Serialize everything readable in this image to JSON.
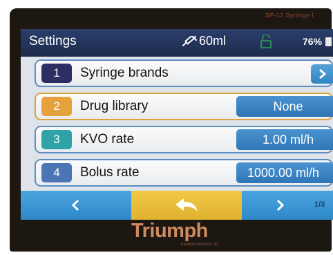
{
  "device": {
    "model": "SP-12 Syringe I",
    "brand": "Triumph",
    "brand_sub": "medical services, llc"
  },
  "status": {
    "title": "Settings",
    "syringe_volume": "60ml",
    "battery": "76%"
  },
  "rows": [
    {
      "num": "1",
      "label": "Syringe brands",
      "num_color": "#2d2f64"
    },
    {
      "num": "2",
      "label": "Drug library",
      "value": "None",
      "num_color": "#e5a23c"
    },
    {
      "num": "3",
      "label": "KVO rate",
      "value": "1.00 ml/h",
      "num_color": "#2fa3a7"
    },
    {
      "num": "4",
      "label": "Bolus rate",
      "value": "1000.00 ml/h",
      "num_color": "#4c76b3"
    }
  ],
  "nav": {
    "page": "1/3"
  },
  "icons": {
    "syringe": "syringe-icon",
    "lock": "lock-icon",
    "battery": "battery-icon",
    "row_arrow": "chevron-right-icon",
    "prev": "chevron-left-icon",
    "back": "return-arrow-icon",
    "next": "chevron-right-icon"
  },
  "colors": {
    "status_bar": "#22345c",
    "row_border": "#5b8cc4",
    "selected_border": "#e0a33a",
    "value_button": "#3a86c6",
    "nav_button": "#3a97d6",
    "back_button": "#eabd3a",
    "brand": "#cf8a5e"
  }
}
